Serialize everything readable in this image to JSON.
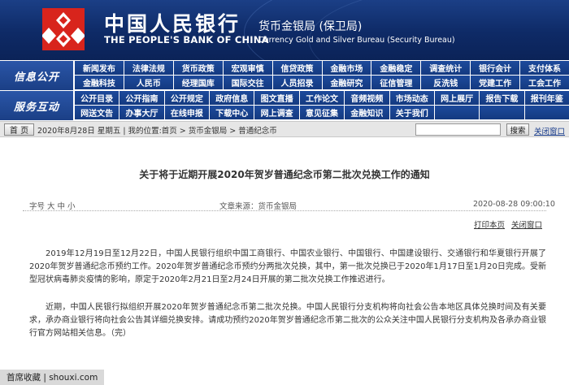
{
  "header": {
    "bank_cn": "中国人民银行",
    "bank_en": "THE PEOPLE'S BANK OF CHINA",
    "bureau_cn": "货币金银局 (保卫局)",
    "bureau_en": "Currency  Gold and Silver Bureau (Security Bureau)"
  },
  "nav": {
    "info_label": "信息公开",
    "service_label": "服务互动",
    "row1": [
      "新闻发布",
      "法律法规",
      "货币政策",
      "宏观审慎",
      "信贷政策",
      "金融市场",
      "金融稳定",
      "调查统计",
      "银行会计",
      "支付体系"
    ],
    "row2": [
      "金融科技",
      "人民币",
      "经理国库",
      "国际交往",
      "人员招录",
      "金融研究",
      "征信管理",
      "反洗钱",
      "党建工作",
      "工会工作"
    ],
    "row3": [
      "公开目录",
      "公开指南",
      "公开规定",
      "政府信息",
      "图文直播",
      "工作论文",
      "音频视频",
      "市场动态",
      "网上展厅",
      "报告下载",
      "报刊年鉴"
    ],
    "row4": [
      "网送文告",
      "办事大厅",
      "在线申报",
      "下载中心",
      "网上调查",
      "意见征集",
      "金融知识",
      "关于我们"
    ]
  },
  "breadcrumb": {
    "home": "首 页",
    "text": "2020年8月28日 星期五  |  我的位置:首页  >  货币金银局  >  普通纪念币",
    "search_value": "",
    "search_button": "搜索",
    "close_window": "关闭窗口"
  },
  "article": {
    "title": "关于将于近期开展2020年贺岁普通纪念币第二批次兑换工作的通知",
    "font_size": "字号 大 中 小",
    "source": "文章来源：货币金银局",
    "date": "2020-08-28  09:00:10",
    "print": "打印本页",
    "close": "关闭窗口",
    "paragraphs": [
      "2019年12月19日至12月22日，中国人民银行组织中国工商银行、中国农业银行、中国银行、中国建设银行、交通银行和华夏银行开展了2020年贺岁普通纪念币预约工作。2020年贺岁普通纪念币预约分两批次兑换，其中，第一批次兑换已于2020年1月17日至1月20日完成。受新型冠状病毒肺炎疫情的影响，原定于2020年2月21日至2月24日开展的第二批次兑换工作推迟进行。",
      "近期，中国人民银行拟组织开展2020年贺岁普通纪念币第二批次兑换。中国人民银行分支机构将向社会公告本地区具体兑换时间及有关要求，承办商业银行将向社会公告其详细兑换安排。请成功预约2020年贺岁普通纪念币第二批次的公众关注中国人民银行分支机构及各承办商业银行官方网站相关信息。（完）"
    ]
  },
  "watermark": "首席收藏 | shouxi.com",
  "colors": {
    "banner": "#0e2a66",
    "nav": "#1b3f86",
    "logo": "#d8241c"
  }
}
